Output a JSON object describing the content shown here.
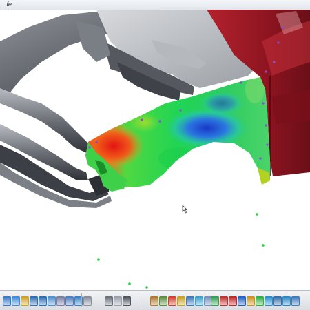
{
  "window": {
    "title": "...fe"
  },
  "viewport": {
    "cursor_icon": "arrow-pointer-icon",
    "analysis_colors": {
      "low": "#1e3cc8",
      "mid": "#18d850",
      "high": "#e21b14",
      "body_red": "#9c1622"
    }
  },
  "toolbar": {
    "groups": [
      {
        "name": "view-tools",
        "buttons": [
          {
            "name": "rotate-icon",
            "color": "#3a78c8"
          },
          {
            "name": "pan-icon",
            "color": "#3f8bd8"
          },
          {
            "name": "compass-icon",
            "color": "#d0a020"
          },
          {
            "name": "zoom-in-icon",
            "color": "#2e6db4"
          },
          {
            "name": "zoom-out-icon",
            "color": "#2e6db4"
          },
          {
            "name": "fit-all-icon",
            "color": "#4a90d0"
          },
          {
            "name": "normal-view-icon",
            "color": "#7a7fa6"
          },
          {
            "name": "iso-view-icon",
            "color": "#4c7ec2"
          },
          {
            "name": "front-view-icon",
            "color": "#3c82c8"
          },
          {
            "name": "section-icon",
            "color": "#8a8fa0"
          }
        ]
      },
      {
        "name": "render-tools",
        "buttons": [
          {
            "name": "shading-icon",
            "color": "#6a6f7a"
          },
          {
            "name": "wireframe-icon",
            "color": "#9aa0ab"
          },
          {
            "name": "camera-icon",
            "color": "#50555f"
          }
        ]
      },
      {
        "name": "analysis-tools",
        "buttons": [
          {
            "name": "magnifier-icon",
            "color": "#b07a30"
          },
          {
            "name": "grid-icon",
            "color": "#5a8f40"
          },
          {
            "name": "palette-icon",
            "color": "#d04030"
          },
          {
            "name": "measure-icon",
            "color": "#c8a020"
          },
          {
            "name": "surface-icon",
            "color": "#4078c0"
          },
          {
            "name": "color-map-icon",
            "color": "#3aa0d0"
          },
          {
            "name": "scale-icon",
            "color": "#7090c0"
          }
        ]
      },
      {
        "name": "output-tools",
        "buttons": [
          {
            "name": "report-icon",
            "color": "#30a050"
          },
          {
            "name": "export-icon",
            "color": "#c03030"
          },
          {
            "name": "car-icon",
            "color": "#c02828"
          },
          {
            "name": "probe-icon",
            "color": "#2060c0"
          },
          {
            "name": "pencil-icon",
            "color": "#d09020"
          },
          {
            "name": "table-icon",
            "color": "#30b040"
          },
          {
            "name": "chart-icon",
            "color": "#2a8fd0"
          },
          {
            "name": "settings-icon",
            "color": "#3070b0"
          },
          {
            "name": "window-icon",
            "color": "#2a88c8"
          },
          {
            "name": "help-icon",
            "color": "#3a7ac0"
          }
        ]
      }
    ]
  }
}
